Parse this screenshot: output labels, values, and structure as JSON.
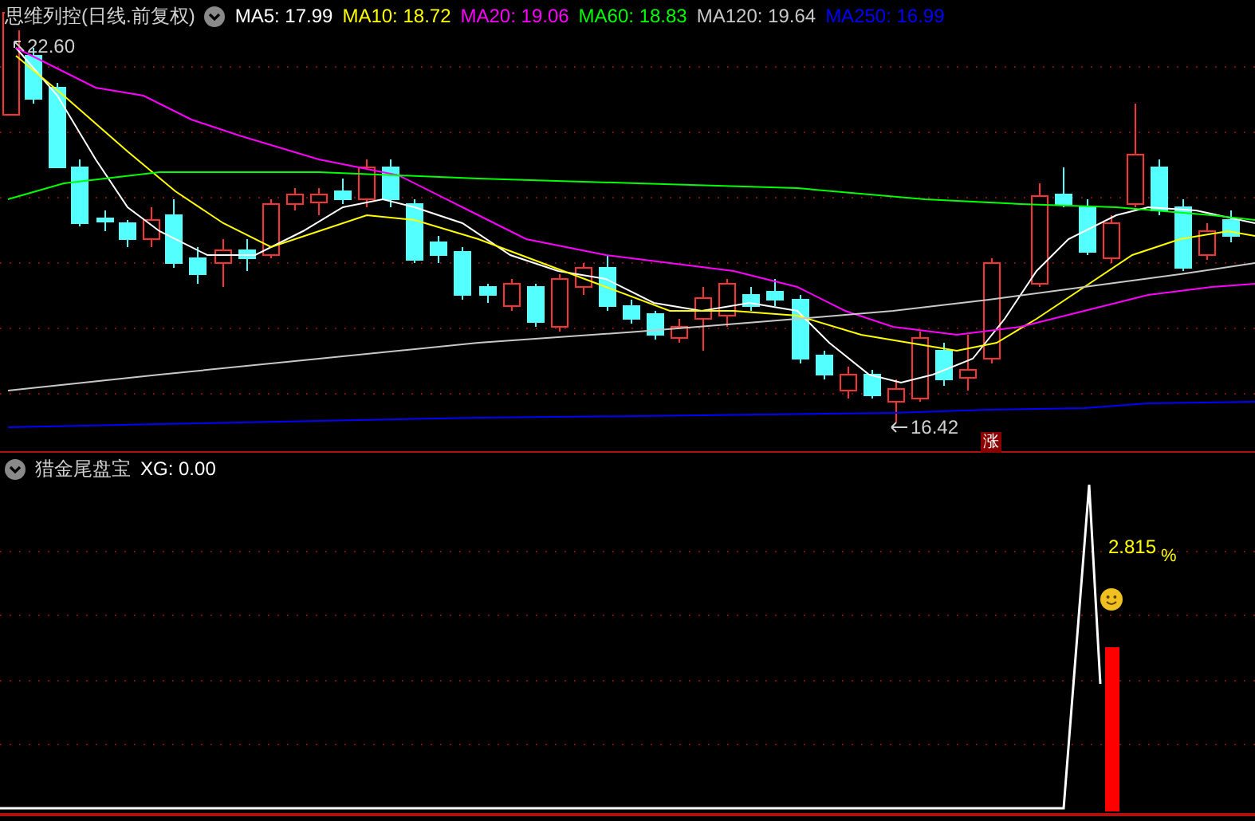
{
  "main_panel": {
    "title": "思维列控(日线.前复权)",
    "indicators": [
      {
        "label": "MA5: 17.99",
        "color": "#ffffff"
      },
      {
        "label": "MA10: 18.72",
        "color": "#ffff00"
      },
      {
        "label": "MA20: 19.06",
        "color": "#ff00ff"
      },
      {
        "label": "MA60: 18.83",
        "color": "#00ff00"
      },
      {
        "label": "MA120: 19.64",
        "color": "#c8c8c8"
      },
      {
        "label": "MA250: 16.99",
        "color": "#0000ff"
      }
    ],
    "high_label": "22.60",
    "low_label": "16.42",
    "badge": "涨"
  },
  "sub_panel": {
    "title": "猎金尾盘宝",
    "indicators": [
      {
        "label": "XG: 0.00",
        "color": "#ffffff"
      }
    ],
    "value_label": "2.815",
    "unit": "%"
  }
}
